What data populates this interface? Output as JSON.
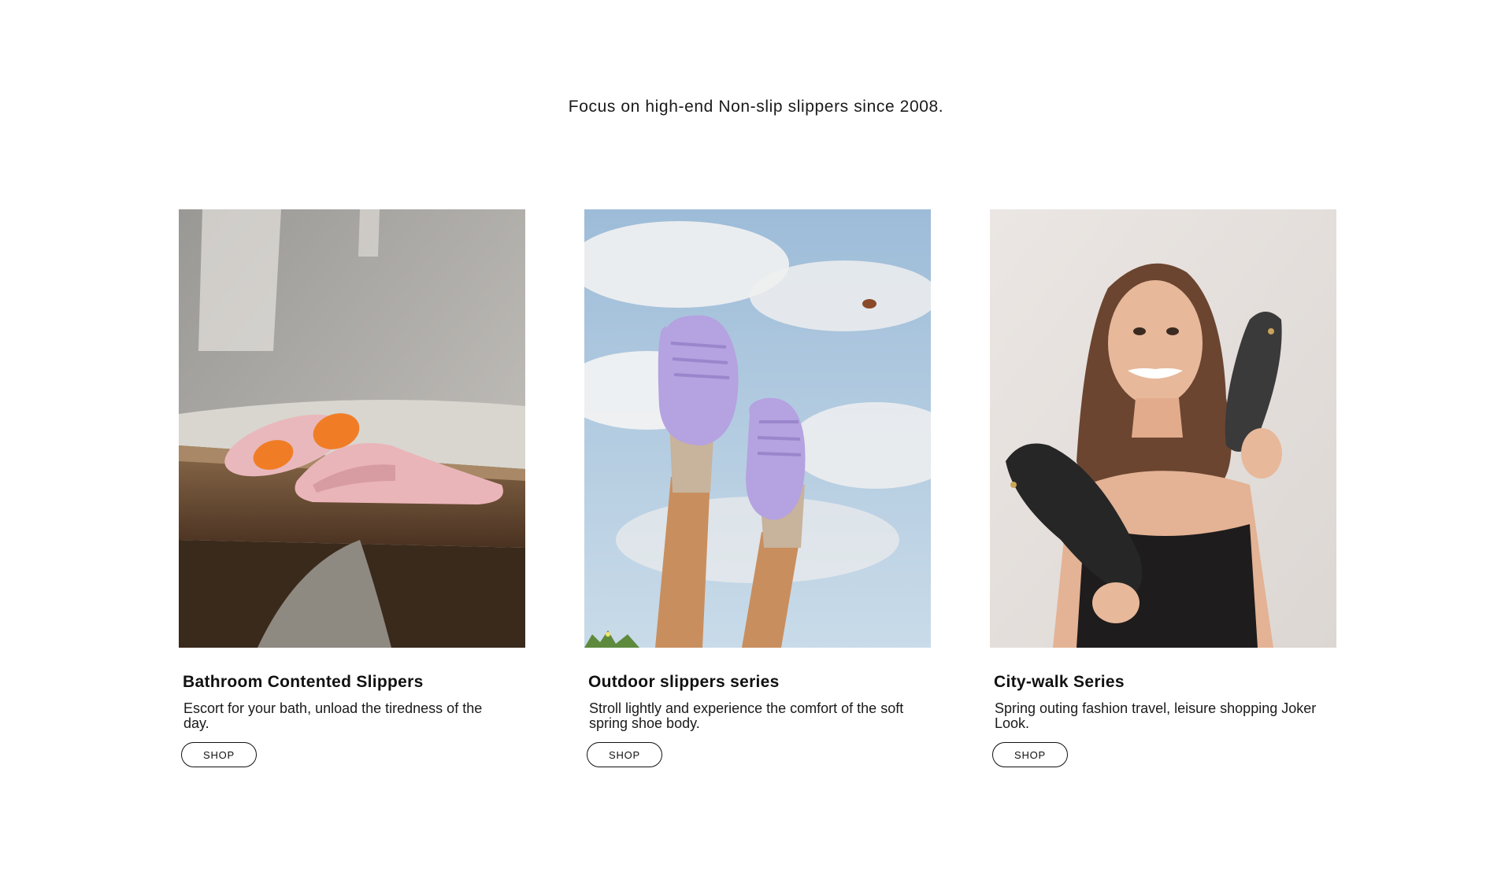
{
  "tagline": "Focus on high-end Non-slip slippers since 2008.",
  "colors": {
    "text": "#111111",
    "background": "#ffffff",
    "button_border": "#111111"
  },
  "cards": [
    {
      "title": "Bathroom Contented Slippers",
      "description": "Escort for your bath, unload the tiredness of the day.",
      "button_label": "SHOP",
      "image": "pink-slide-slippers-on-wooden-bath-shelf"
    },
    {
      "title": "Outdoor slippers series",
      "description": "Stroll lightly and experience the comfort of the soft spring shoe body.",
      "button_label": "SHOP",
      "image": "lavender-clogs-on-raised-feet-against-sky"
    },
    {
      "title": "City-walk Series",
      "description": "Spring outing fashion travel, leisure shopping Joker Look.",
      "button_label": "SHOP",
      "image": "woman-holding-black-flip-flops"
    }
  ]
}
